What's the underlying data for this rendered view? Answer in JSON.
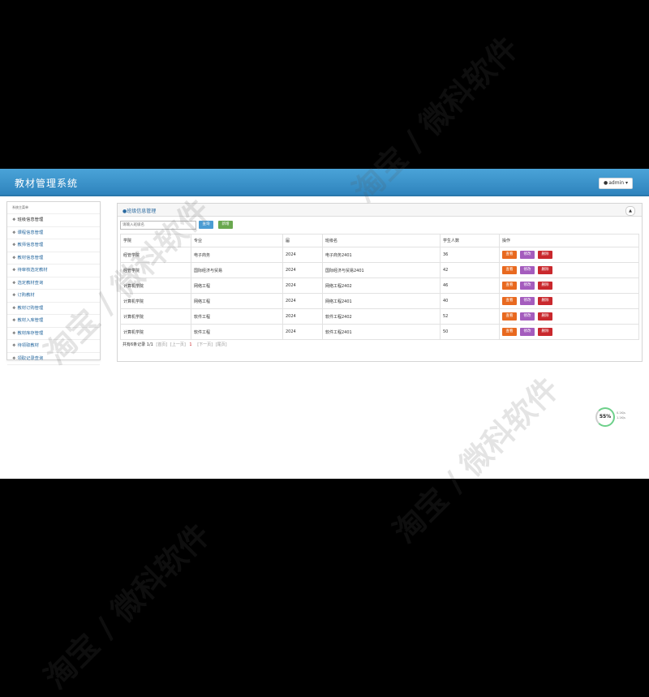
{
  "app": {
    "title": "教材管理系统",
    "user_label": "admin"
  },
  "sidebar": {
    "header": "系统主菜单",
    "items": [
      {
        "label": "班级信息管理"
      },
      {
        "label": "课程信息管理"
      },
      {
        "label": "教师信息管理"
      },
      {
        "label": "教材信息管理"
      },
      {
        "label": "待审核选定教材"
      },
      {
        "label": "选定教材查询"
      },
      {
        "label": "订购教材"
      },
      {
        "label": "教材订购管理"
      },
      {
        "label": "教材入库管理"
      },
      {
        "label": "教材库存管理"
      },
      {
        "label": "待领取教材"
      },
      {
        "label": "领取记录查询"
      }
    ]
  },
  "panel": {
    "title": "班级信息管理",
    "search_placeholder": "请输入班级名",
    "query_label": "查询",
    "add_label": "新增"
  },
  "table": {
    "headers": [
      "学院",
      "专业",
      "届",
      "班级名",
      "学生人数",
      "操作"
    ],
    "rows": [
      [
        "经管学院",
        "电子商务",
        "2024",
        "电子商务2401",
        "36"
      ],
      [
        "经管学院",
        "国际经济与贸易",
        "2024",
        "国际经济与贸易2401",
        "42"
      ],
      [
        "计算机学院",
        "网络工程",
        "2024",
        "网络工程2402",
        "46"
      ],
      [
        "计算机学院",
        "网络工程",
        "2024",
        "网络工程2401",
        "40"
      ],
      [
        "计算机学院",
        "软件工程",
        "2024",
        "软件工程2402",
        "52"
      ],
      [
        "计算机学院",
        "软件工程",
        "2024",
        "软件工程2401",
        "50"
      ]
    ],
    "actions": {
      "view": "查看",
      "edit": "修改",
      "delete": "删除"
    }
  },
  "pager": {
    "summary": "共有6条记录",
    "page": "1/1",
    "first": "[首页]",
    "prev": "[上一页]",
    "current": "1",
    "next": "[下一页]",
    "last": "[尾页]"
  },
  "watermark": "淘宝 / 微科软件",
  "widget": {
    "percent": "55%",
    "up": "0.1K/s",
    "down": "1.1K/s"
  }
}
